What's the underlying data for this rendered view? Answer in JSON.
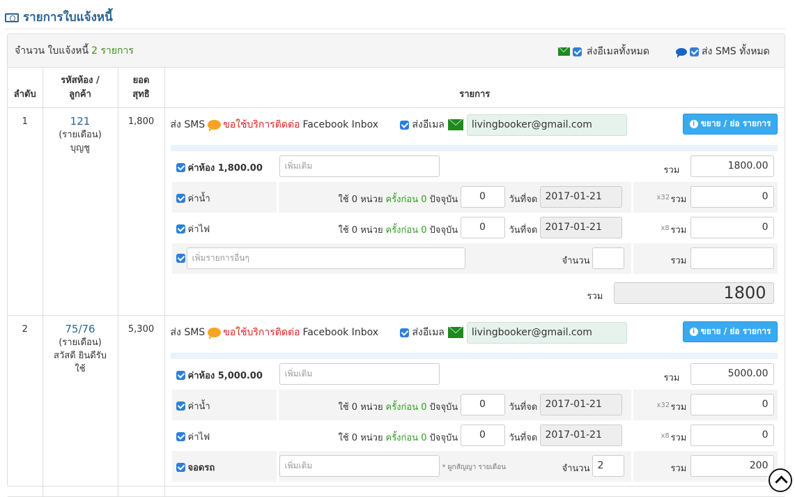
{
  "page": {
    "title": "รายการใบแจ้งหนี้"
  },
  "panel": {
    "count_label": "จำนวน ใบแจ้งหนี้",
    "count_value": "2 รายการ",
    "send_all_email": "ส่งอีเมลทั้งหมด",
    "send_all_sms": "ส่ง SMS ทั้งหมด"
  },
  "columns": {
    "order": "ลำดับ",
    "room_customer": "รหัสห้อง / ลูกค้า",
    "net": "ยอด สุทธิ",
    "items": "รายการ"
  },
  "labels": {
    "send_sms": "ส่ง SMS",
    "sms_service": "ขอใช้บริการติดต่อ",
    "fb_inbox": "Facebook Inbox",
    "send_email": "ส่งอีเมล",
    "expand_button": "ขยาย / ย่อ รายการ",
    "total": "รวม",
    "used": "ใช้ 0 หน่วย",
    "previous": "ครั้งก่อน 0",
    "current": "ปัจจุบัน",
    "record_date": "วันที่จด",
    "quantity": "จำนวน",
    "add_more_placeholder": "เพิ่มเติม",
    "add_other_placeholder": "เพิ่มรายการอื่นๆ",
    "contract_note": "* ผูกสัญญา รายเดือน"
  },
  "invoices": [
    {
      "order": "1",
      "room": "121",
      "type": "(รายเดือน)",
      "customer": "บุญชู",
      "net": "1,800",
      "email": "livingbooker@gmail.com",
      "rent_label": "ค่าห้อง 1,800.00",
      "rent_total": "1800.00",
      "water_label": "ค่าน้ำ",
      "water_current": "0",
      "water_date": "2017-01-21",
      "water_mult": "x32",
      "water_total": "0",
      "elec_label": "ค่าไฟ",
      "elec_current": "0",
      "elec_date": "2017-01-21",
      "elec_mult": "x8",
      "elec_total": "0",
      "grand_total": "1800"
    },
    {
      "order": "2",
      "room": "75/76",
      "type": "(รายเดือน)",
      "customer": "สวัสดี ยินดีรับใช้",
      "net": "5,300",
      "email": "livingbooker@gmail.com",
      "rent_label": "ค่าห้อง 5,000.00",
      "rent_total": "5000.00",
      "water_label": "ค่าน้ำ",
      "water_current": "0",
      "water_date": "2017-01-21",
      "water_mult": "x32",
      "water_total": "0",
      "elec_label": "ค่าไฟ",
      "elec_current": "0",
      "elec_date": "2017-01-21",
      "elec_mult": "x8",
      "elec_total": "0",
      "parking_label": "จอดรถ",
      "parking_qty": "2",
      "parking_total": "200"
    }
  ],
  "colors": {
    "primary_link": "#2a6496",
    "green": "#2d9e1c",
    "red": "#d9261c",
    "button": "#39aaf0",
    "checkbox": "#2f7fd8"
  }
}
